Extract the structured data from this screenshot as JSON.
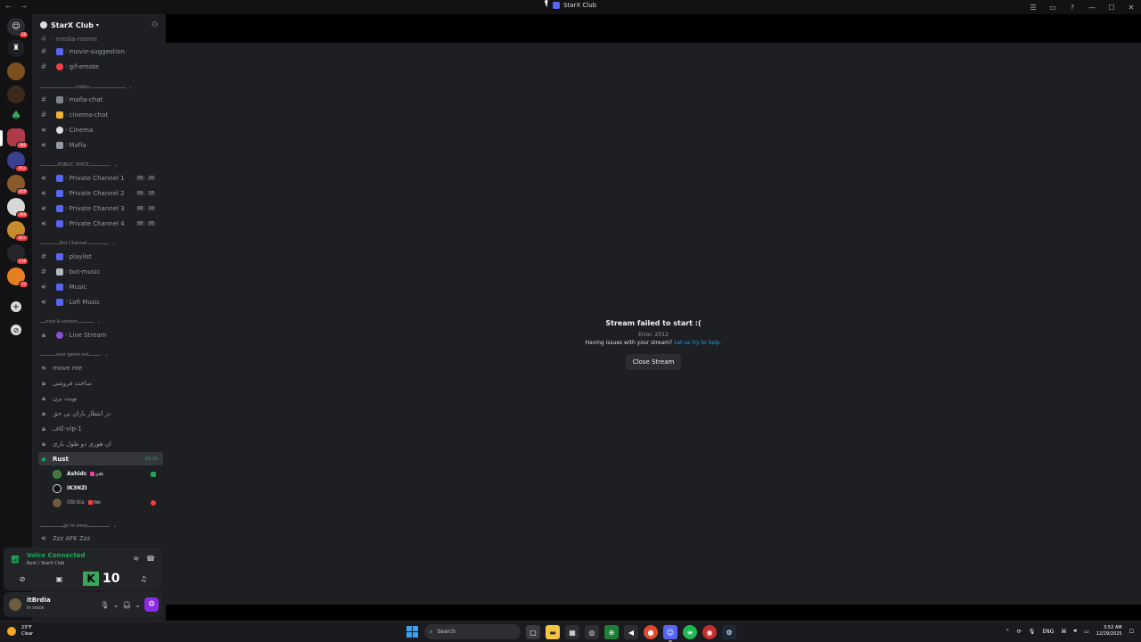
{
  "window": {
    "title": "StarX Club",
    "nav": "← →"
  },
  "server": {
    "name": "StarX Club"
  },
  "rail": {
    "badges": [
      "19",
      "386",
      "7K+",
      "819",
      "499",
      "1K+",
      "116",
      "73"
    ]
  },
  "channels": {
    "partial_top": "media-meme",
    "movie_suggestion": "movie-suggestion",
    "gif_emote": "gif-emote",
    "cat_hobby": "hobby",
    "mafia_chat": "mafia-chat",
    "cinema_chat": "cinema-chat",
    "cinema": "Cinema",
    "mafia": "Mafia",
    "cat_public_voice": "PUBLIC VOICE",
    "pc1": "Private Channel 1",
    "pc1_count": [
      "00",
      "20"
    ],
    "pc2": "Private Channel 2",
    "pc2_count": [
      "00",
      "15"
    ],
    "pc3": "Private Channel 3",
    "pc3_count": [
      "00",
      "10"
    ],
    "pc4": "Private Channel 4",
    "pc4_count": [
      "00",
      "05"
    ],
    "cat_bot": "Bot Channel",
    "playlist": "playlist",
    "bot_music": "bot-music",
    "music": "Music",
    "lofi": "Lofi Music",
    "cat_mod": "mod & stream",
    "live_stream": "Live Stream",
    "cat_user_game": "user game net",
    "move_me": "move me",
    "sacht_forushi": "ساخت فروشی",
    "nobat_bezan": "نوبت بزن",
    "dar_entezar": "در انتظار باران بی حق",
    "vip": "کاف-vip-1",
    "harvari": "ان هوری دو طول باری",
    "rust": "Rust",
    "rust_timer": "29:10",
    "cat_sleep": "go to sleep",
    "afk": "Zzz AFK Zzz"
  },
  "voice_users": [
    {
      "name": "Ashidc",
      "tag": "ஜoL"
    },
    {
      "name": "IK3NZI",
      "tag": ""
    },
    {
      "name": "itBrdia",
      "tag": "FNX"
    }
  ],
  "voice_panel": {
    "title": "Voice Connected",
    "subtitle": "Rust / StarX Club",
    "k_label": "K",
    "number": "10"
  },
  "user_bar": {
    "name": "itBrdia",
    "status": "In voice"
  },
  "stream": {
    "title": "Stream failed to start :(",
    "error": "Error: 2012",
    "help_text": "Having issues with your stream?",
    "help_link": "Let us try to help.",
    "close_button": "Close Stream"
  },
  "taskbar": {
    "temp": "23°F",
    "weather": "Clear",
    "search_placeholder": "Search",
    "lang": "ENG",
    "time": "3:52 AM",
    "date": "12/29/2025"
  }
}
